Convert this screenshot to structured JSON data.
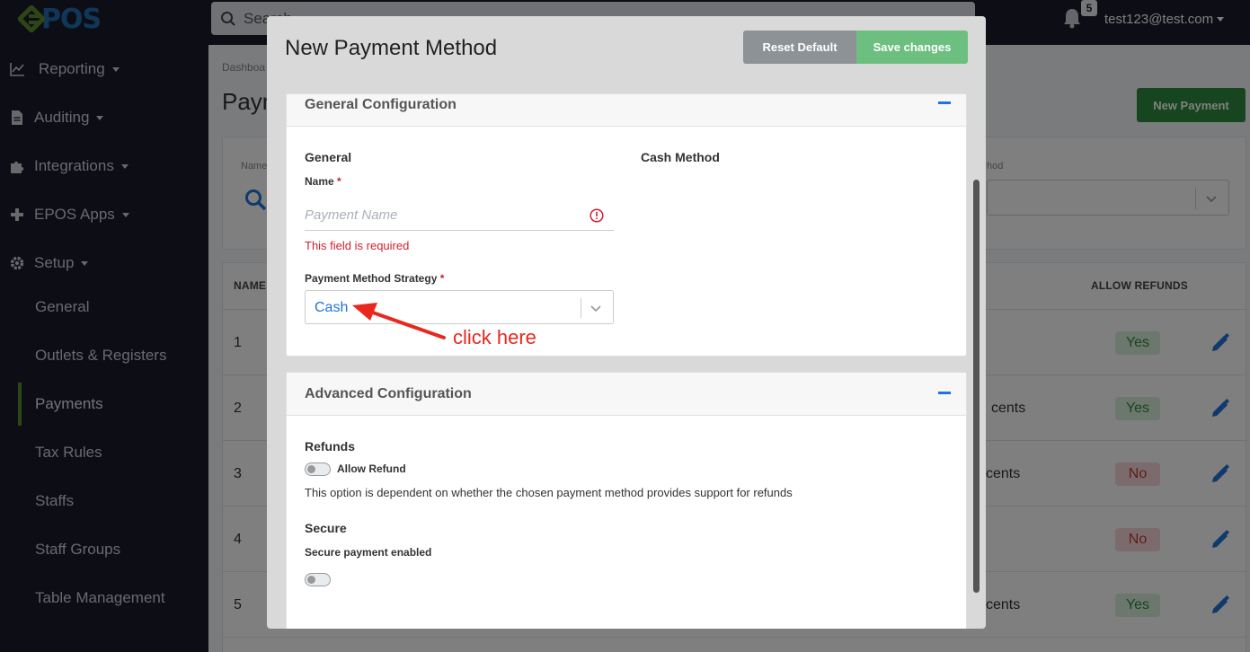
{
  "brand": {
    "logo_text": "POS"
  },
  "topbar": {
    "search_placeholder": "Search",
    "notifications_count": "5",
    "user_email": "test123@test.com"
  },
  "sidebar": {
    "items": [
      {
        "label": "Reporting",
        "icon": "chart-line-icon"
      },
      {
        "label": "Auditing",
        "icon": "document-icon"
      },
      {
        "label": "Integrations",
        "icon": "puzzle-icon"
      },
      {
        "label": "EPOS Apps",
        "icon": "plus-icon"
      },
      {
        "label": "Setup",
        "icon": "gear-icon"
      }
    ],
    "sub_items": [
      {
        "label": "General"
      },
      {
        "label": "Outlets & Registers"
      },
      {
        "label": "Payments",
        "active": true
      },
      {
        "label": "Tax Rules"
      },
      {
        "label": "Staffs"
      },
      {
        "label": "Staff Groups"
      },
      {
        "label": "Table Management"
      }
    ]
  },
  "page": {
    "breadcrumb": "Dashboa",
    "title": "Paym",
    "new_payment_label": "New Payment",
    "filter": {
      "left_label": "Name",
      "right_label": "hod"
    },
    "table": {
      "headers": {
        "name": "NAME",
        "allow_refunds": "ALLOW REFUNDS"
      },
      "rows": [
        {
          "num": "1",
          "cents": "",
          "allow_refunds": "Yes"
        },
        {
          "num": "2",
          "cents": "cents",
          "allow_refunds": "Yes"
        },
        {
          "num": "3",
          "cents": "cents",
          "allow_refunds": "No"
        },
        {
          "num": "4",
          "cents": "",
          "allow_refunds": "No"
        },
        {
          "num": "5",
          "cents": "cents",
          "allow_refunds": "Yes"
        }
      ]
    }
  },
  "modal": {
    "title": "New Payment Method",
    "reset_label": "Reset Default",
    "save_label": "Save changes",
    "general_config": {
      "title": "General Configuration",
      "general_heading": "General",
      "cash_heading": "Cash Method",
      "name_label": "Name",
      "required_mark": "*",
      "name_placeholder": "Payment Name",
      "name_error": "This field is required",
      "strategy_label": "Payment Method Strategy",
      "strategy_value": "Cash"
    },
    "advanced_config": {
      "title": "Advanced Configuration",
      "refunds_heading": "Refunds",
      "allow_refund_label": "Allow Refund",
      "allow_refund_help": "This option is dependent on whether the chosen payment method provides support for refunds",
      "secure_heading": "Secure",
      "secure_label": "Secure payment enabled"
    }
  },
  "annotation": {
    "text": "click here",
    "color": "#e8281d"
  },
  "colors": {
    "accent": "#1f74d6",
    "brand_green": "#5a8a2e",
    "error": "#d0212f"
  }
}
